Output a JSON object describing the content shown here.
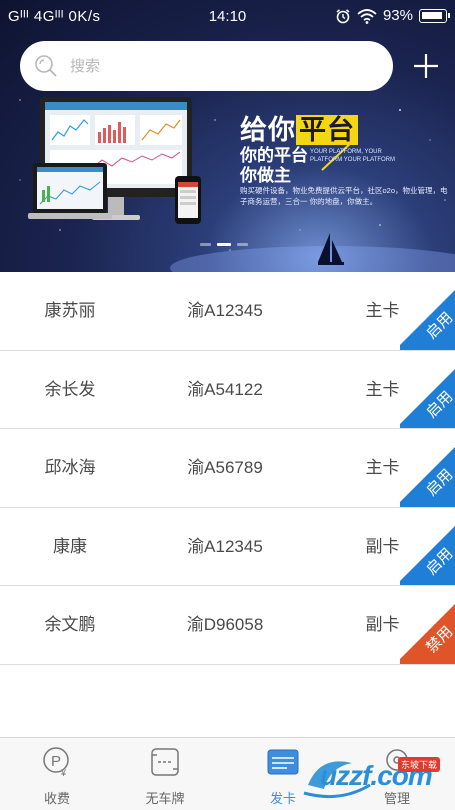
{
  "status_bar": {
    "carrier": "Gᴵᴵᴵ 4Gᴵᴵᴵ 0K/s",
    "time": "14:10",
    "battery": "93%"
  },
  "search": {
    "placeholder": "搜索"
  },
  "banner": {
    "title_prefix": "给你",
    "title_highlight": "平台",
    "sub_line1": "你的平台",
    "sub_line2": "你做主",
    "sub_small": "YOUR PLATFORM, YOUR PLATFORM YOUR PLATFORM",
    "description": "购买硬件设备，物业免费提供云平台，社区o2o，物业管理，电子商务运营，三合一 你的地盘，你做主。",
    "slide_count": 3,
    "active_slide": 1
  },
  "records": [
    {
      "name": "康苏丽",
      "plate": "渝A12345",
      "card": "主卡",
      "status": "启用",
      "status_color": "#1f7fd6"
    },
    {
      "name": "余长发",
      "plate": "渝A54122",
      "card": "主卡",
      "status": "启用",
      "status_color": "#1f7fd6"
    },
    {
      "name": "邱冰海",
      "plate": "渝A56789",
      "card": "主卡",
      "status": "启用",
      "status_color": "#1f7fd6"
    },
    {
      "name": "康康",
      "plate": "渝A12345",
      "card": "副卡",
      "status": "启用",
      "status_color": "#1f7fd6"
    },
    {
      "name": "余文鹏",
      "plate": "渝D96058",
      "card": "副卡",
      "status": "禁用",
      "status_color": "#e0542a"
    }
  ],
  "tabs": [
    {
      "label": "收费",
      "icon": "parking-fee-icon"
    },
    {
      "label": "无车牌",
      "icon": "no-plate-icon"
    },
    {
      "label": "发卡",
      "icon": "card-issue-icon"
    },
    {
      "label": "管理",
      "icon": "manage-icon"
    }
  ],
  "watermark": {
    "text": "uzzf.com",
    "badge": "东坡下载"
  },
  "colors": {
    "enabled": "#1f7fd6",
    "disabled": "#e0542a",
    "banner_dark": "#1b2450"
  }
}
